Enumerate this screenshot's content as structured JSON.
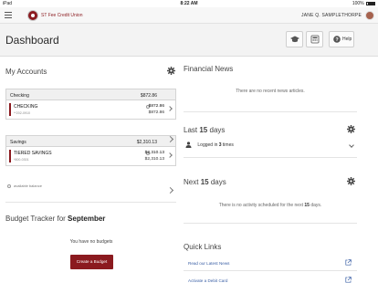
{
  "status_bar": {
    "device": "iPad",
    "time": "8:22 AM",
    "battery": "100%"
  },
  "topnav": {
    "brand": "ST Fee Credit Union",
    "username": "JANE Q. SAMPLETHORPE"
  },
  "header": {
    "title": "Dashboard",
    "help_label": "Help"
  },
  "accounts": {
    "title": "My Accounts",
    "groups": [
      {
        "name": "Checking",
        "total": "$872.86",
        "rows": [
          {
            "name": "CHECKING",
            "number": "**202-0910",
            "available": "$872.86",
            "current": "$872.86"
          }
        ]
      },
      {
        "name": "Savings",
        "total": "$2,310.13",
        "rows": [
          {
            "name": "TIERED SAVINGS",
            "number": "*800-0301",
            "available": "$2,310.13",
            "current": "$2,310.13"
          }
        ]
      }
    ],
    "legend": "available balance"
  },
  "budget": {
    "title_prefix": "Budget Tracker for",
    "month": "September",
    "empty_message": "You have no budgets",
    "create_label": "Create a Budget"
  },
  "news": {
    "title": "Financial News",
    "empty_message": "There are no recent news articles."
  },
  "last_days": {
    "prefix": "Last",
    "count": "15",
    "suffix": "days",
    "logged_prefix": "Logged in",
    "logged_count": "3",
    "logged_suffix": "times"
  },
  "next_days": {
    "prefix": "Next",
    "count": "15",
    "suffix": "days",
    "message_prefix": "There is no activity scheduled for the next",
    "message_count": "15",
    "message_suffix": "days."
  },
  "quick_links": {
    "title": "Quick Links",
    "items": [
      {
        "label": "Read our Latest News"
      },
      {
        "label": "Activate a Debit Card"
      }
    ]
  },
  "colors": {
    "brand": "#8b1a1f",
    "link": "#3a5fa5",
    "header_bg": "#f3f3f3"
  }
}
